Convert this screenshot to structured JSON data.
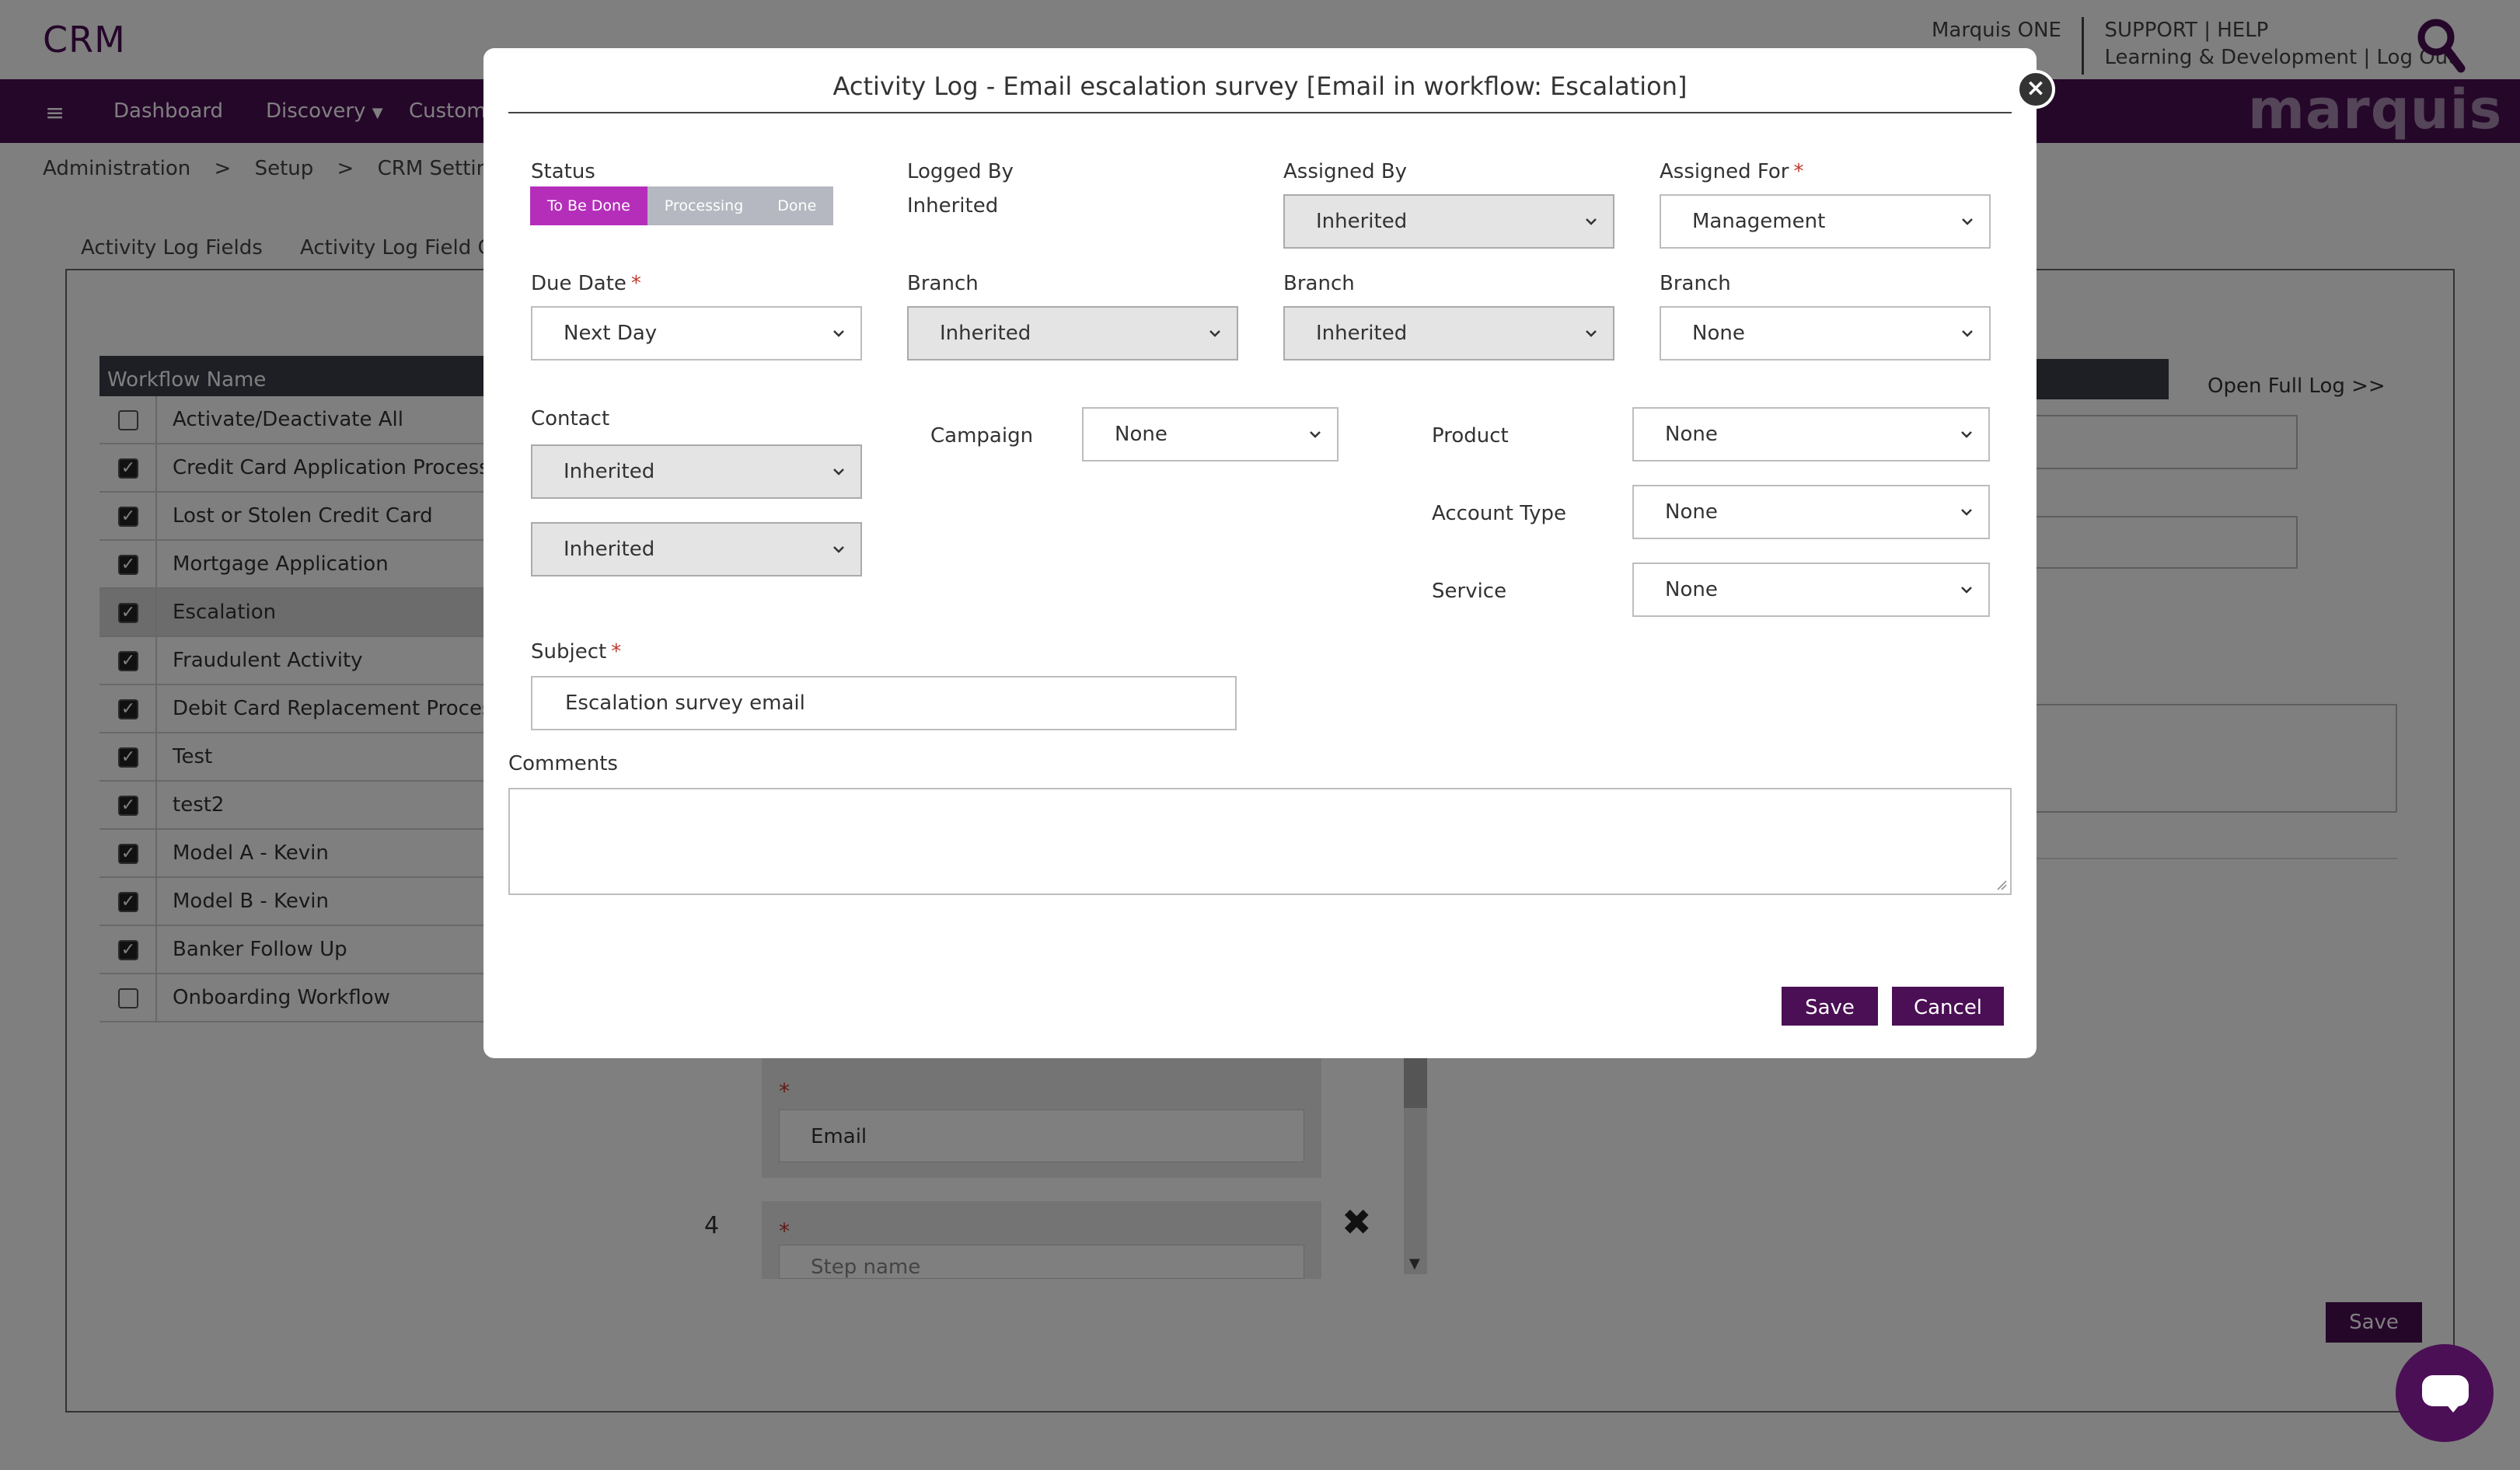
{
  "app": {
    "brand": "CRM",
    "top_links": {
      "product": "Marquis ONE",
      "support": "SUPPORT",
      "help": "HELP",
      "learning": "Learning & Development",
      "logout": "Log Out",
      "sep": "|"
    },
    "logo_text": "marquis",
    "nav": {
      "items": [
        "Dashboard",
        "Discovery",
        "Custome"
      ]
    },
    "breadcrumb": [
      "Administration",
      ">",
      "Setup",
      ">",
      "CRM Settings"
    ],
    "subtabs": [
      "Activity Log Fields",
      "Activity Log Field Gro"
    ],
    "workflow_table": {
      "header": "Workflow Name",
      "rows": [
        {
          "label": "Activate/Deactivate All",
          "checked": false
        },
        {
          "label": "Credit Card Application Process",
          "checked": true
        },
        {
          "label": "Lost or Stolen Credit Card",
          "checked": true
        },
        {
          "label": "Mortgage Application",
          "checked": true
        },
        {
          "label": "Escalation",
          "checked": true,
          "selected": true
        },
        {
          "label": "Fraudulent Activity",
          "checked": true
        },
        {
          "label": "Debit Card Replacement Process",
          "checked": true
        },
        {
          "label": "Test",
          "checked": true
        },
        {
          "label": "test2",
          "checked": true
        },
        {
          "label": "Model A - Kevin",
          "checked": true
        },
        {
          "label": "Model B - Kevin",
          "checked": true
        },
        {
          "label": "Banker Follow Up",
          "checked": true
        },
        {
          "label": "Onboarding Workflow",
          "checked": false
        }
      ]
    },
    "open_full_log": "Open Full Log >>",
    "steps": {
      "step3_type": "Email",
      "step4_number": "4",
      "step4_placeholder": "Step name",
      "required": "*"
    },
    "bg_save": "Save"
  },
  "modal": {
    "title": "Activity Log - Email escalation survey [Email in workflow: Escalation]",
    "status": {
      "label": "Status",
      "options": [
        "To Be Done",
        "Processing",
        "Done"
      ],
      "active": "To Be Done"
    },
    "logged_by": {
      "label": "Logged By",
      "value": "Inherited"
    },
    "assigned_by": {
      "label": "Assigned By",
      "value": "Inherited"
    },
    "assigned_for": {
      "label": "Assigned For",
      "value": "Management",
      "required": "*"
    },
    "due_date": {
      "label": "Due Date",
      "value": "Next Day",
      "required": "*"
    },
    "branch1": {
      "label": "Branch",
      "value": "Inherited"
    },
    "branch2": {
      "label": "Branch",
      "value": "Inherited"
    },
    "branch3": {
      "label": "Branch",
      "value": "None"
    },
    "contact": {
      "label": "Contact",
      "value1": "Inherited",
      "value2": "Inherited"
    },
    "campaign": {
      "label": "Campaign",
      "value": "None"
    },
    "product": {
      "label": "Product",
      "value": "None"
    },
    "account_type": {
      "label": "Account Type",
      "value": "None"
    },
    "service": {
      "label": "Service",
      "value": "None"
    },
    "subject": {
      "label": "Subject",
      "value": "Escalation survey email",
      "required": "*"
    },
    "comments": {
      "label": "Comments",
      "value": ""
    },
    "save_label": "Save",
    "cancel_label": "Cancel",
    "close_glyph": "×"
  },
  "colors": {
    "brand_purple": "#4b0f55",
    "status_active": "#b52eba",
    "status_inactive": "#b5b8c0",
    "required": "#c0392b"
  }
}
